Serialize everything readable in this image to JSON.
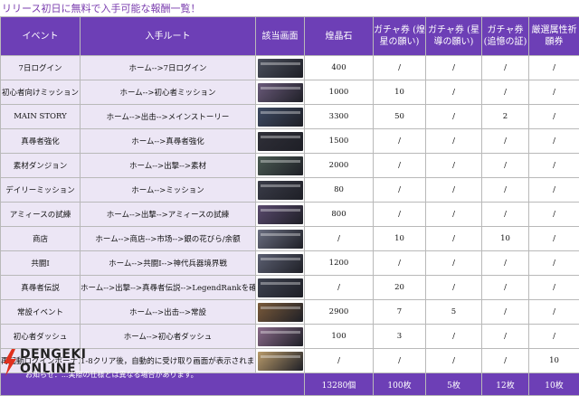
{
  "title": "リリース初日に無料で入手可能な報酬一覧！",
  "headers": [
    "イベント",
    "入手ルート",
    "該当画面",
    "煌晶石",
    "ガチャ券\n(煌星の願い)",
    "ガチャ券\n(星導の願い)",
    "ガチャ券\n(追憶の証)",
    "厳選属性祈願券"
  ],
  "rows": [
    {
      "event": "7日ログイン",
      "route": "ホーム-->7日ログイン",
      "shot_color": "#4a4f5c",
      "v": [
        "400",
        "/",
        "/",
        "/",
        "/"
      ]
    },
    {
      "event": "初心者向けミッション",
      "route": "ホーム-->初心者ミッション",
      "shot_color": "#6a5a7a",
      "v": [
        "1000",
        "10",
        "/",
        "/",
        "/"
      ]
    },
    {
      "event": "MAIN STORY",
      "route": "ホーム-->出击-->メインストーリー",
      "shot_color": "#3d4a63",
      "v": [
        "3300",
        "50",
        "/",
        "2",
        "/"
      ]
    },
    {
      "event": "真尋者強化",
      "route": "ホーム-->真尋者強化",
      "shot_color": "#2f2f38",
      "v": [
        "1500",
        "/",
        "/",
        "/",
        "/"
      ]
    },
    {
      "event": "素材ダンジョン",
      "route": "ホーム-->出撃-->素材",
      "shot_color": "#4a5a52",
      "v": [
        "2000",
        "/",
        "/",
        "/",
        "/"
      ]
    },
    {
      "event": "デイリーミッション",
      "route": "ホーム-->ミッション",
      "shot_color": "#3a3c48",
      "v": [
        "80",
        "/",
        "/",
        "/",
        "/"
      ]
    },
    {
      "event": "アミィースの試練",
      "route": "ホーム-->出撃-->アミィースの試練",
      "shot_color": "#5a4a6e",
      "v": [
        "800",
        "/",
        "/",
        "/",
        "/"
      ]
    },
    {
      "event": "商店",
      "route": "ホーム-->商店-->市场-->銀の花びら/余额",
      "shot_color": "#6a6e80",
      "v": [
        "/",
        "10",
        "/",
        "10",
        "/"
      ]
    },
    {
      "event": "共闘I",
      "route": "ホーム-->共闘I-->神代兵器境界戦",
      "shot_color": "#5c6072",
      "v": [
        "1200",
        "/",
        "/",
        "/",
        "/"
      ]
    },
    {
      "event": "真尋者伝説",
      "route": "ホーム-->出撃-->真尋者伝説-->LegendRankを確認",
      "shot_color": "#3e4250",
      "v": [
        "/",
        "20",
        "/",
        "/",
        "/"
      ]
    },
    {
      "event": "常設イベント",
      "route": "ホーム-->出击-->常設",
      "shot_color": "#7a5a3a",
      "v": [
        "2900",
        "7",
        "5",
        "/",
        "/"
      ]
    },
    {
      "event": "初心者ダッシュ",
      "route": "ホーム-->初心者ダッシュ",
      "shot_color": "#8a6a8a",
      "v": [
        "100",
        "3",
        "/",
        "/",
        "/"
      ]
    },
    {
      "event": "再起動ログインボーナス",
      "route": "1-8クリア後，自動的に受け取り画面が表示されます",
      "shot_color": "#b89a6a",
      "v": [
        "/",
        "/",
        "/",
        "/",
        "10"
      ]
    }
  ],
  "totals": [
    "13280個",
    "100枚",
    "5枚",
    "12枚",
    "10枚"
  ],
  "footnote": "お知らせ：...実際の仕様とは異なる場合があります。",
  "logo": {
    "line1": "DENGEKI",
    "line2": "ONLINE",
    "mark_color": "#e0301e"
  }
}
